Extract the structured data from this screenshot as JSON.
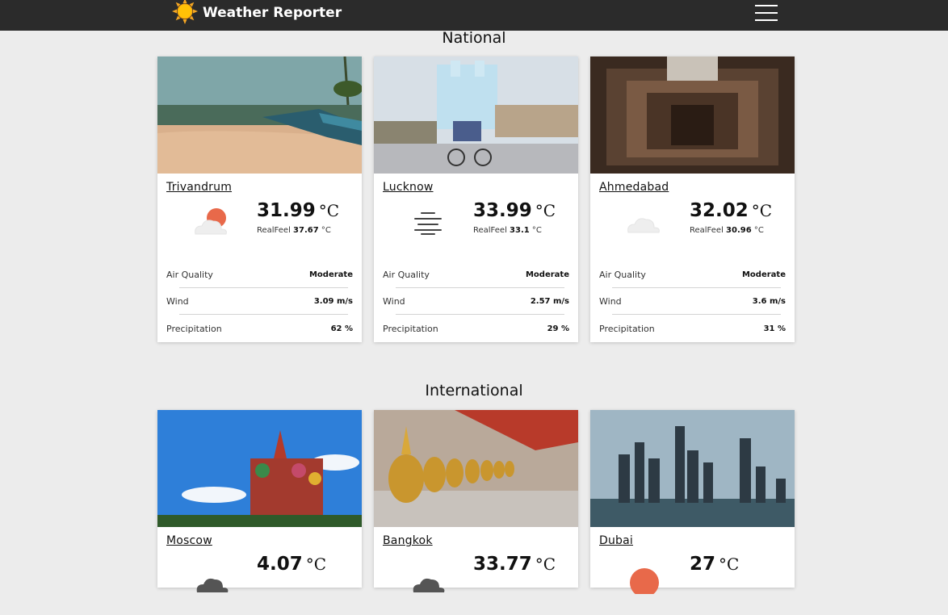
{
  "app": {
    "title": "Weather Reporter"
  },
  "sections": {
    "national": {
      "title": "National"
    },
    "international": {
      "title": "International"
    }
  },
  "labels": {
    "air_quality": "Air Quality",
    "wind": "Wind",
    "precipitation": "Precipitation",
    "realfeel": "RealFeel"
  },
  "temp_unit": "°C",
  "national": [
    {
      "city": "Trivandrum",
      "icon": "partly-sunny-icon",
      "temp": "31.99",
      "realfeel": "37.67",
      "air_quality": "Moderate",
      "wind": "3.09 m/s",
      "precipitation": "62 %"
    },
    {
      "city": "Lucknow",
      "icon": "haze-icon",
      "temp": "33.99",
      "realfeel": "33.1",
      "air_quality": "Moderate",
      "wind": "2.57 m/s",
      "precipitation": "29 %"
    },
    {
      "city": "Ahmedabad",
      "icon": "cloud-icon",
      "temp": "32.02",
      "realfeel": "30.96",
      "air_quality": "Moderate",
      "wind": "3.6 m/s",
      "precipitation": "31 %"
    }
  ],
  "international": [
    {
      "city": "Moscow",
      "icon": "dark-cloud-icon",
      "temp": "4.07"
    },
    {
      "city": "Bangkok",
      "icon": "dark-cloud-icon",
      "temp": "33.77"
    },
    {
      "city": "Dubai",
      "icon": "sun-icon",
      "temp": "27"
    }
  ],
  "colors": {
    "navbar": "#2b2b2b",
    "background": "#ececec",
    "sun": "#e8694a"
  }
}
